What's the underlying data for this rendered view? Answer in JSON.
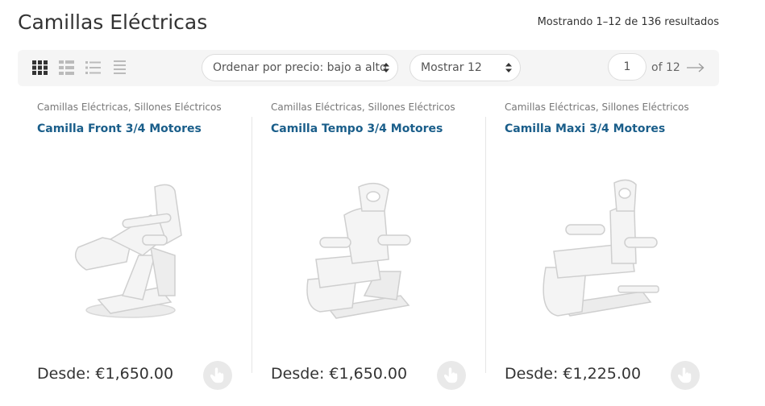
{
  "page": {
    "title": "Camillas Eléctricas",
    "result_count": "Mostrando 1–12 de 136 resultados"
  },
  "toolbar": {
    "view_modes": [
      "grid-large-icon",
      "grid-small-icon",
      "list-icon",
      "list-compact-icon"
    ],
    "sort_label": "Ordenar por precio: bajo a alto",
    "show_label": "Mostrar 12",
    "page_current": "1",
    "page_of": "of 12"
  },
  "products": [
    {
      "categories": "Camillas Eléctricas, Sillones Eléctricos",
      "title": "Camilla Front 3/4 Motores",
      "price": "Desde: €1,650.00",
      "image_icon": "electric-stretcher-image"
    },
    {
      "categories": "Camillas Eléctricas, Sillones Eléctricos",
      "title": "Camilla Tempo 3/4 Motores",
      "price": "Desde: €1,650.00",
      "image_icon": "electric-stretcher-image"
    },
    {
      "categories": "Camillas Eléctricas, Sillones Eléctricos",
      "title": "Camilla Maxi 3/4 Motores",
      "price": "Desde: €1,225.00",
      "image_icon": "electric-stretcher-image"
    }
  ],
  "colors": {
    "title_link": "#1a5e8a",
    "toolbar_bg": "#f5f5f5",
    "cart_button_bg": "#e9e9e9"
  }
}
